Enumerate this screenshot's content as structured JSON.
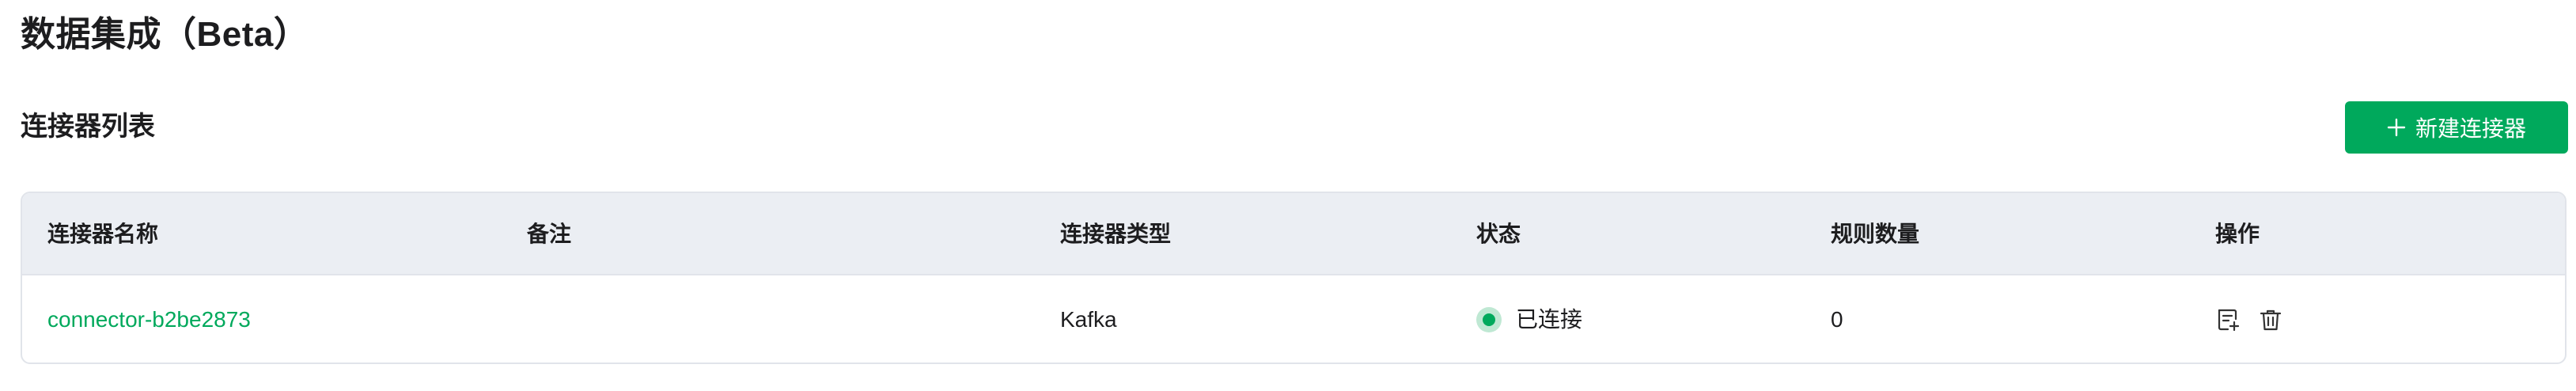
{
  "page": {
    "title": "数据集成（Beta）"
  },
  "section": {
    "title": "连接器列表",
    "new_button_label": "新建连接器"
  },
  "table": {
    "columns": [
      "连接器名称",
      "备注",
      "连接器类型",
      "状态",
      "规则数量",
      "操作"
    ],
    "rows": [
      {
        "name": "connector-b2be2873",
        "remark": "",
        "type": "Kafka",
        "status": "已连接",
        "rule_count": "0",
        "actions": [
          "edit-rules-icon",
          "trash-icon"
        ]
      }
    ]
  },
  "colors": {
    "accent": "#00a95c",
    "header_bg": "#ebeef3",
    "border": "#e1e4ea"
  }
}
